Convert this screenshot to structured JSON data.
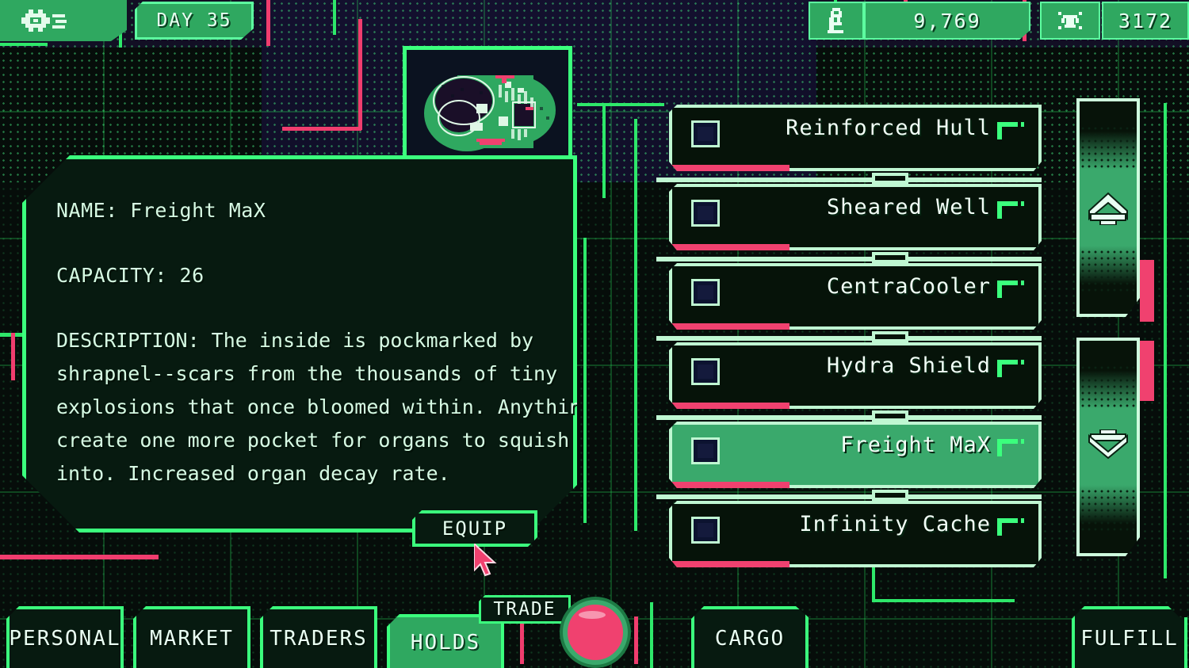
{
  "topbar": {
    "settings_icon": "gear-icon",
    "day_label": "DAY 35",
    "money_icon": "credits-icon",
    "money_value": "9,769",
    "organ_icon": "organ-icon",
    "organ_value": "3172"
  },
  "portrait": {
    "icon": "organ-item-portrait"
  },
  "info": {
    "name_label": "NAME: Freight MaX",
    "capacity_label": "CAPACITY: 26",
    "description_lines": [
      "DESCRIPTION: The inside is pockmarked by",
      "shrapnel--scars from the thousands of tiny",
      "explosions that once bloomed within. Anything to",
      "create one more pocket for organs to squish",
      "into. Increased organ decay rate."
    ],
    "equip_label": "EQUIP"
  },
  "item_list": {
    "items": [
      {
        "label": "Reinforced Hull",
        "selected": false,
        "checked": false
      },
      {
        "label": "Sheared Well",
        "selected": false,
        "checked": false
      },
      {
        "label": "CentraCooler",
        "selected": false,
        "checked": false
      },
      {
        "label": "Hydra Shield",
        "selected": false,
        "checked": false
      },
      {
        "label": "Freight MaX",
        "selected": true,
        "checked": false
      },
      {
        "label": "Infinity Cache",
        "selected": false,
        "checked": false
      }
    ]
  },
  "scroll": {
    "up_icon": "chevron-up-icon",
    "down_icon": "chevron-down-icon"
  },
  "bottombar": {
    "tabs": [
      {
        "id": "personal",
        "label": "PERSONAL",
        "active": false
      },
      {
        "id": "market",
        "label": "MARKET",
        "active": false
      },
      {
        "id": "traders",
        "label": "TRADERS",
        "active": false
      },
      {
        "id": "holds",
        "label": "HOLDS",
        "active": true
      },
      {
        "id": "cargo",
        "label": "CARGO",
        "active": false
      },
      {
        "id": "fulfill",
        "label": "FULFILL",
        "active": false
      }
    ],
    "trade_label": "TRADE",
    "trade_button_icon": "trade-button"
  },
  "colors": {
    "bright_green": "#3bff7d",
    "mid_green": "#2fa860",
    "pale_green": "#bff7d2",
    "pink": "#f0416f",
    "dark_bg": "#061309",
    "navy": "#141030"
  }
}
